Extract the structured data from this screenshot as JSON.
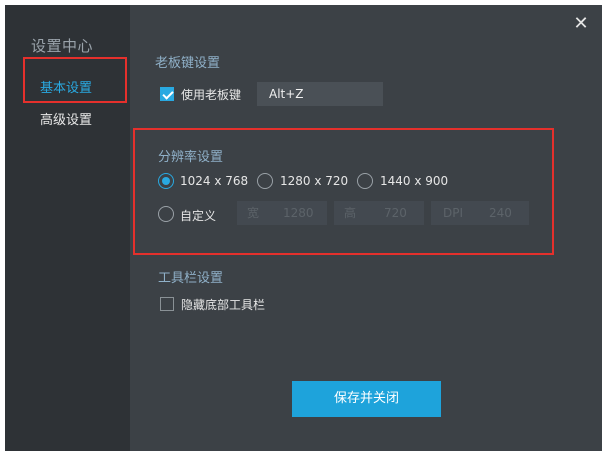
{
  "window": {
    "close_glyph": "✕"
  },
  "sidebar": {
    "title": "设置中心",
    "items": [
      {
        "label": "基本设置",
        "active": true
      },
      {
        "label": "高级设置",
        "active": false
      }
    ]
  },
  "boss_key": {
    "section_title": "老板键设置",
    "checkbox_label": "使用老板键",
    "checked": true,
    "hotkey_value": "Alt+Z"
  },
  "resolution": {
    "section_title": "分辨率设置",
    "options": [
      {
        "label": "1024 x 768",
        "selected": true
      },
      {
        "label": "1280 x 720",
        "selected": false
      },
      {
        "label": "1440 x 900",
        "selected": false
      }
    ],
    "custom": {
      "label": "自定义",
      "selected": false,
      "width_label": "宽",
      "width_value": "1280",
      "height_label": "高",
      "height_value": "720",
      "dpi_label": "DPI",
      "dpi_value": "240"
    }
  },
  "toolbar": {
    "section_title": "工具栏设置",
    "checkbox_label": "隐藏底部工具栏",
    "checked": false
  },
  "actions": {
    "save_label": "保存并关闭"
  },
  "colors": {
    "accent": "#29a9e1",
    "highlight_box": "#e5302c",
    "window_bg": "#3c4146",
    "sidebar_bg": "#2e3236"
  }
}
